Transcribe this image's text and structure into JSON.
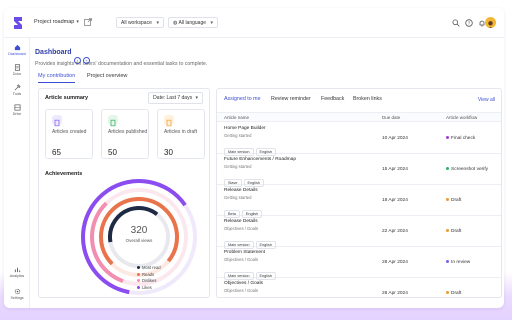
{
  "header": {
    "project": "Project roadmap",
    "workspace": "All workspace",
    "language": "All language"
  },
  "sidebar": {
    "items": [
      {
        "label": "Dashboard",
        "icon": "dashboard-icon"
      },
      {
        "label": "Docs",
        "icon": "docs-icon"
      },
      {
        "label": "Tools",
        "icon": "tools-icon"
      },
      {
        "label": "Drive",
        "icon": "drive-icon"
      },
      {
        "label": "Analytics",
        "icon": "analytics-icon"
      },
      {
        "label": "Settings",
        "icon": "settings-icon"
      }
    ]
  },
  "page": {
    "title": "Dashboard",
    "subtitle": "Provides insights on users' documentation and essential tasks to complete.",
    "tabs": [
      "My contribution",
      "Project overview"
    ]
  },
  "summary": {
    "title": "Article summary",
    "date_filter": "Date: Last 7 days",
    "stats": [
      {
        "label": "Articles created",
        "value": "65",
        "color": "#8b6cf0",
        "bg": "#efe9ff"
      },
      {
        "label": "Articles published",
        "value": "50",
        "color": "#3fb66a",
        "bg": "#e5f7ea"
      },
      {
        "label": "Articles in draft",
        "value": "30",
        "color": "#f0a640",
        "bg": "#fff1dc"
      }
    ]
  },
  "achievements": {
    "title": "Achievements",
    "total": "320",
    "total_label": "Overall views",
    "legend": [
      {
        "label": "Most read",
        "color": "#1f2a44"
      },
      {
        "label": "Reads",
        "color": "#e9734a"
      },
      {
        "label": "Dislikes",
        "color": "#f28fb0"
      },
      {
        "label": "Likes",
        "color": "#8b4cf0"
      }
    ]
  },
  "tasks": {
    "tabs": [
      "Assigned to me",
      "Review reminder",
      "Feedback",
      "Broken links"
    ],
    "view_all": "View all",
    "columns": [
      "Article name",
      "Due date",
      "Article workflow"
    ],
    "rows": [
      {
        "name": "Home Page Builder",
        "category": "Getting started",
        "tags": [
          "Main version",
          "English"
        ],
        "due": "10 Apr 2024",
        "status": "Final check",
        "status_color": "#9b3fd6"
      },
      {
        "name": "Future Enhancements / Roadmap",
        "category": "Getting started",
        "tags": [
          "Slave",
          "English"
        ],
        "due": "15 Apr 2024",
        "status": "Screenshot verify",
        "status_color": "#2fb36a"
      },
      {
        "name": "Release Details",
        "category": "Getting started",
        "tags": [
          "Beta",
          "English"
        ],
        "due": "18 Apr 2024",
        "status": "Draft",
        "status_color": "#f09a30"
      },
      {
        "name": "Release Details",
        "category": "Objectives / Goals",
        "tags": [
          "Main version",
          "English"
        ],
        "due": "22 Apr 2024",
        "status": "Draft",
        "status_color": "#f09a30"
      },
      {
        "name": "Problem Statement",
        "category": "Objectives / Goals",
        "tags": [
          "Main version",
          "English"
        ],
        "due": "28 Apr 2024",
        "status": "In review",
        "status_color": "#7c5ce8"
      },
      {
        "name": "Objectives / Goals",
        "category": "Objectives / Goals",
        "tags": [
          "Main version",
          "English"
        ],
        "due": "28 Apr 2024",
        "status": "Draft",
        "status_color": "#f09a30"
      }
    ]
  }
}
